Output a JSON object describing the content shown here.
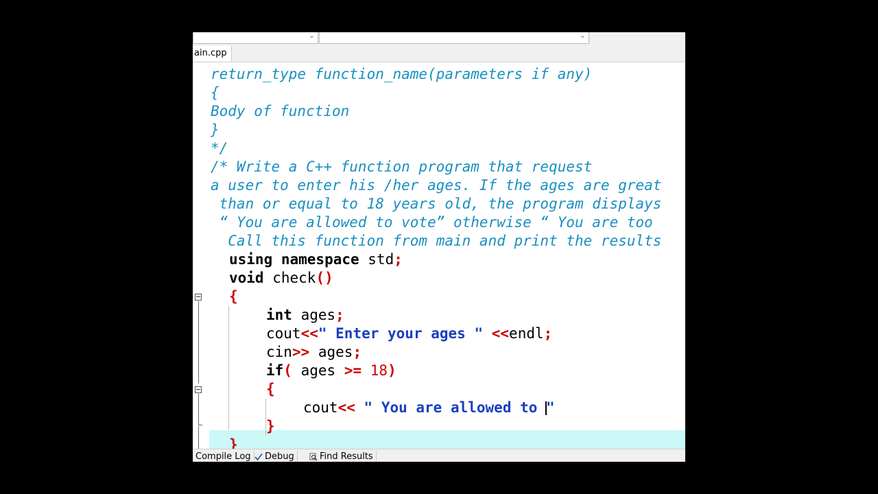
{
  "editor": {
    "tab_label": "ain.cpp",
    "comment_lines": [
      "return_type function_name(parameters if any)",
      "{",
      "Body of function",
      "}",
      "*/",
      "/* Write a C++ function program that request",
      "a user to enter his /her ages. If the ages are great",
      " than or equal to 18 years old, the program displays",
      " “ You are allowed to vote” otherwise “ You are too",
      "  Call this function from main and print the results"
    ],
    "code": {
      "using_kw": "using namespace",
      "using_id": " std",
      "semicolon": ";",
      "void_kw": "void",
      "check_fn": " check",
      "parens": "()",
      "open_brace": "{",
      "int_kw": "int",
      "ages_var": " ages",
      "cout_kw": "cout",
      "shift_left": "<<",
      "enter_str": "\" Enter your ages \"",
      "space": " ",
      "endl_kw": "endl",
      "cin_kw": "cin",
      "shift_right": ">>",
      "if_kw": "if",
      "paren_open": "(",
      "ges_op": ">=",
      "eighteen": "18",
      "paren_close": ")",
      "allowed_str": "\" You are allowed to ",
      "quote_end": "\"",
      "close_brace": "}"
    }
  },
  "bottom_tabs": {
    "compile_log": "Compile Log",
    "debug": "Debug",
    "find_results": "Find Results"
  },
  "colors": {
    "comment": "#1a8fc0",
    "string": "#1a3fbf",
    "symbol": "#cc0000",
    "current_line": "#ccf8f8"
  }
}
